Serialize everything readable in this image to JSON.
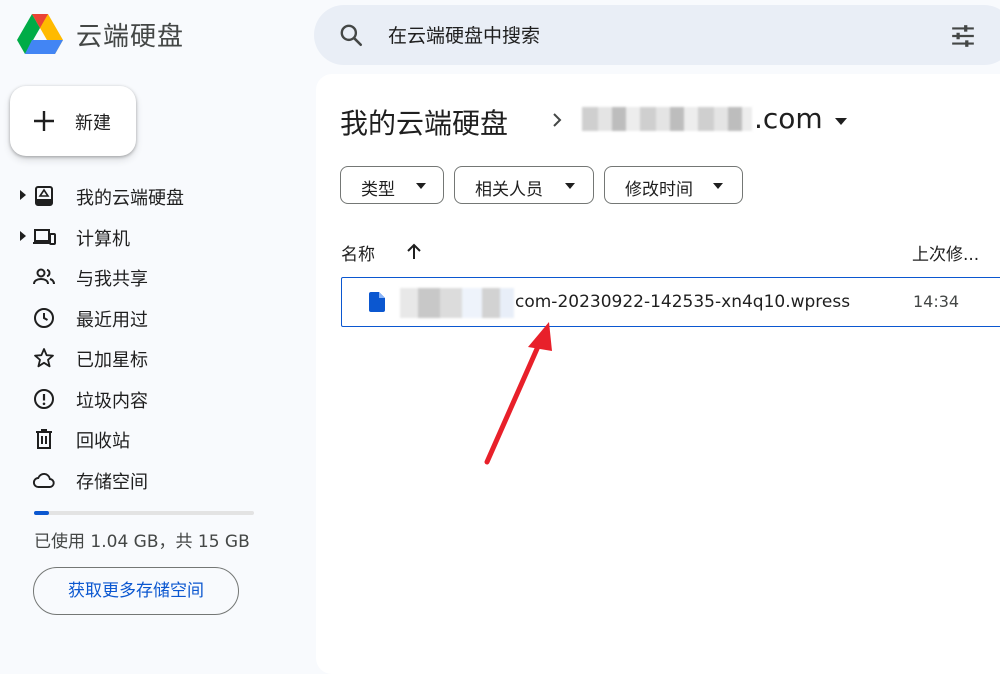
{
  "app": {
    "title": "云端硬盘",
    "logo_icon": "drive-logo-icon"
  },
  "search": {
    "placeholder": "在云端硬盘中搜索",
    "icon": "search-icon",
    "options_icon": "tune-icon"
  },
  "new_button": {
    "label": "新建",
    "icon": "plus-icon"
  },
  "sidebar": {
    "items": [
      {
        "label": "我的云端硬盘",
        "icon": "my-drive-icon",
        "expandable": true
      },
      {
        "label": "计算机",
        "icon": "computer-icon",
        "expandable": true
      },
      {
        "label": "与我共享",
        "icon": "shared-people-icon",
        "expandable": false
      },
      {
        "label": "最近用过",
        "icon": "clock-icon",
        "expandable": false
      },
      {
        "label": "已加星标",
        "icon": "star-icon",
        "expandable": false
      },
      {
        "label": "垃圾内容",
        "icon": "spam-icon",
        "expandable": false
      },
      {
        "label": "回收站",
        "icon": "trash-icon",
        "expandable": false
      },
      {
        "label": "存储空间",
        "icon": "cloud-icon",
        "expandable": false
      }
    ]
  },
  "storage": {
    "usage_text": "已使用 1.04 GB，共 15 GB",
    "used_fraction": 0.069,
    "get_more_label": "获取更多存储空间"
  },
  "breadcrumb": {
    "root": "我的云端硬盘",
    "current_suffix": ".com"
  },
  "filters": [
    {
      "label": "类型"
    },
    {
      "label": "相关人员"
    },
    {
      "label": "修改时间"
    }
  ],
  "table": {
    "columns": {
      "name": "名称",
      "modified": "上次修..."
    },
    "rows": [
      {
        "name_visible": "com-20230922-142535-xn4q10.wpress",
        "modified": "14:34",
        "icon": "file-icon"
      }
    ]
  },
  "colors": {
    "accent": "#0b57d0",
    "annotation_arrow": "#e8202a",
    "background": "#f8fafd",
    "search_bg": "#e9eef6"
  }
}
